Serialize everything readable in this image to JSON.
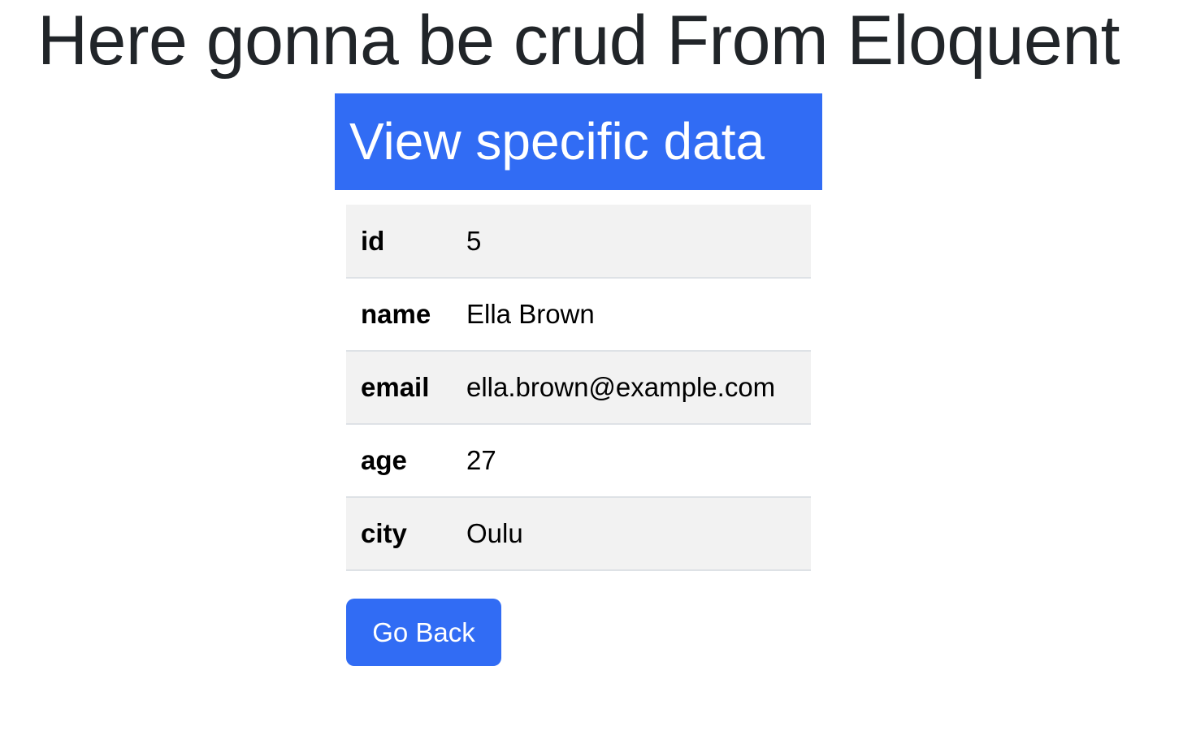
{
  "page": {
    "title": "Here gonna be crud From Eloquent"
  },
  "card": {
    "header": "View specific data"
  },
  "record": [
    {
      "key": "id",
      "value": "5"
    },
    {
      "key": "name",
      "value": "Ella Brown"
    },
    {
      "key": "email",
      "value": "ella.brown@example.com"
    },
    {
      "key": "age",
      "value": "27"
    },
    {
      "key": "city",
      "value": "Oulu"
    }
  ],
  "actions": {
    "back_label": "Go Back"
  },
  "colors": {
    "accent": "#316cf4",
    "stripe": "#f2f2f2",
    "text": "#212529"
  }
}
